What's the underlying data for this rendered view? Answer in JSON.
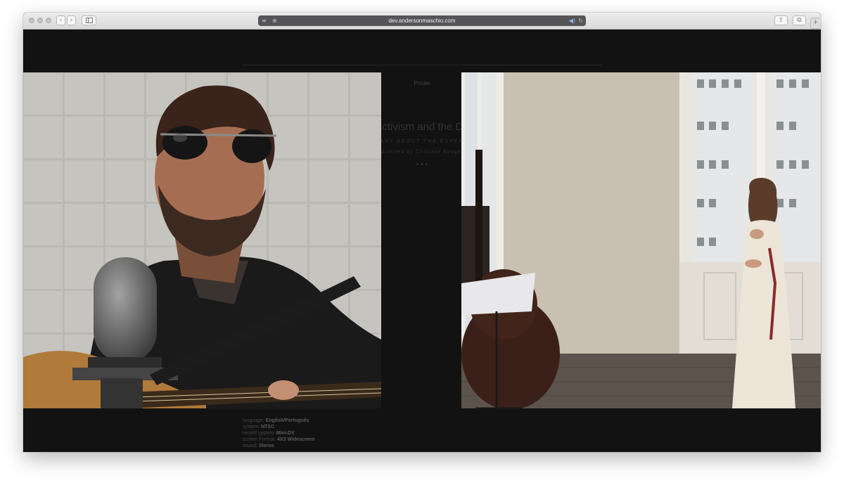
{
  "browser": {
    "url": "dev.andersonmaschio.com",
    "buttons": {
      "back": "‹",
      "forward": "›",
      "share": "⇪",
      "tabs": "⧉",
      "new_tab": "+"
    },
    "icons": [
      "reader-icon",
      "add-icon",
      "sound-icon",
      "reload-icon",
      "sidebar-icon"
    ]
  },
  "page": {
    "nav_label": "Poster",
    "heading": "Activism and the Do",
    "subheading": "ARY ABOUT THE EXPER",
    "credit": "Directed by Cristiane Bouger",
    "ellipsis": "• • •",
    "specs": [
      {
        "label": "language:",
        "value": "English/Português"
      },
      {
        "label": "system:",
        "value": "NTSC"
      },
      {
        "label": "record system:",
        "value": "Mini-DV"
      },
      {
        "label": "screen Format:",
        "value": "4X3 Widescreen"
      },
      {
        "label": "sound:",
        "value": "Stereo"
      }
    ]
  },
  "frames": {
    "left": {
      "name": "video-frame-guitarist"
    },
    "right": {
      "name": "video-frame-singer-and-bassist"
    }
  },
  "colors": {
    "overlay": "#121212",
    "toolbar": "#e3e3e3",
    "address_bar": "#555558"
  }
}
